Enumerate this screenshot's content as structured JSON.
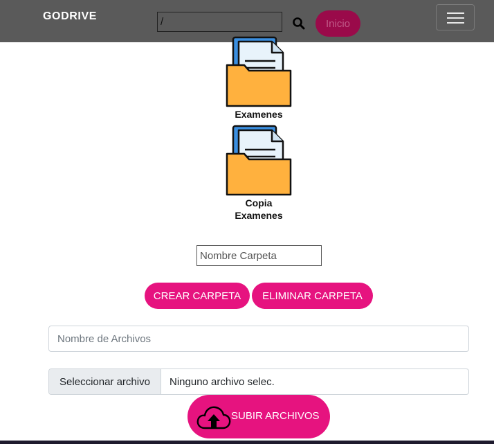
{
  "nav": {
    "brand": "GODRIVE",
    "path_value": "/",
    "search_icon": "search-icon",
    "home_button": "Inicio",
    "menu_icon": "hamburger-menu-icon"
  },
  "folders": [
    {
      "name": "Examenes",
      "icon": "folder-icon"
    },
    {
      "name": "Copia Examenes",
      "icon": "folder-icon"
    }
  ],
  "folder_form": {
    "name_placeholder": "Nombre Carpeta",
    "create_label": "CREAR CARPETA",
    "delete_label": "ELIMINAR CARPETA"
  },
  "upload_form": {
    "files_placeholder": "Nombre de Archivos",
    "choose_file_label": "Seleccionar archivo",
    "file_status": "Ninguno archivo selec.",
    "upload_label": "SUBIR ARCHIVOS",
    "upload_icon": "cloud-upload-icon"
  },
  "colors": {
    "navbar": "#5a5a5a",
    "accent": "#e6137f",
    "folder": "#ffb13e",
    "document": "#e8f3fb",
    "back_sheet": "#3b8fe0"
  }
}
